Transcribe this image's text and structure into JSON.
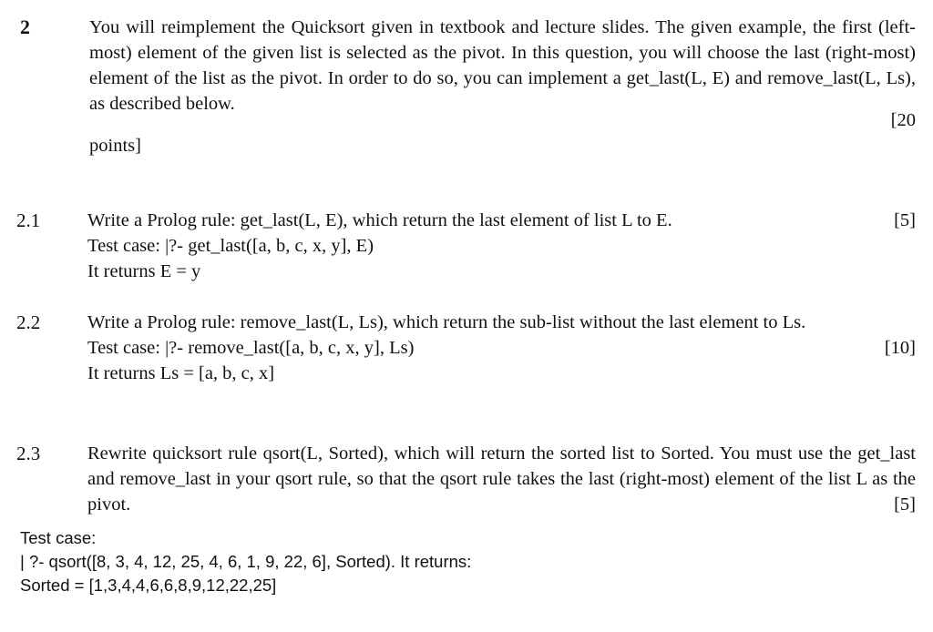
{
  "document": {
    "questions": [
      {
        "number": "2",
        "paragraphs": [
          "You will reimplement the Quicksort given in textbook and lecture slides. The given example, the first (left-most) element of the given list is selected as the pivot. In this question, you will choose the last (right-most) element of the list as the pivot. In order to do so, you can implement a get_last(L, E) and remove_last(L, Ls), as described below."
        ],
        "mark": "[20",
        "mark_continuation": "points]"
      },
      {
        "number": "2.1",
        "prompt": "Write a Prolog rule: get_last(L, E), which return the last element of list L to E.",
        "test_case": "Test case: |?- get_last([a, b, c, x, y], E)",
        "result": "It returns E = y",
        "mark": "[5]"
      },
      {
        "number": "2.2",
        "prompt": "Write a Prolog rule: remove_last(L, Ls), which return the sub-list without the last element to Ls.",
        "test_case": "Test case: |?- remove_last([a, b, c, x, y], Ls)",
        "result": "It returns Ls = [a, b, c, x]",
        "mark": "[10]"
      },
      {
        "number": "2.3",
        "prompt": "Rewrite quicksort rule qsort(L, Sorted), which will return the sorted list to Sorted. You must use the get_last and remove_last in your qsort rule, so that the qsort rule takes the last (right-most) element of the list L as the pivot.",
        "mark": "[5]"
      }
    ],
    "final_test_case": {
      "heading": "Test case:",
      "query": "| ?- qsort([8, 3, 4, 12, 25, 4, 6, 1, 9, 22, 6], Sorted). It returns:",
      "result": "Sorted = [1,3,4,4,6,6,8,9,12,22,25]"
    }
  }
}
